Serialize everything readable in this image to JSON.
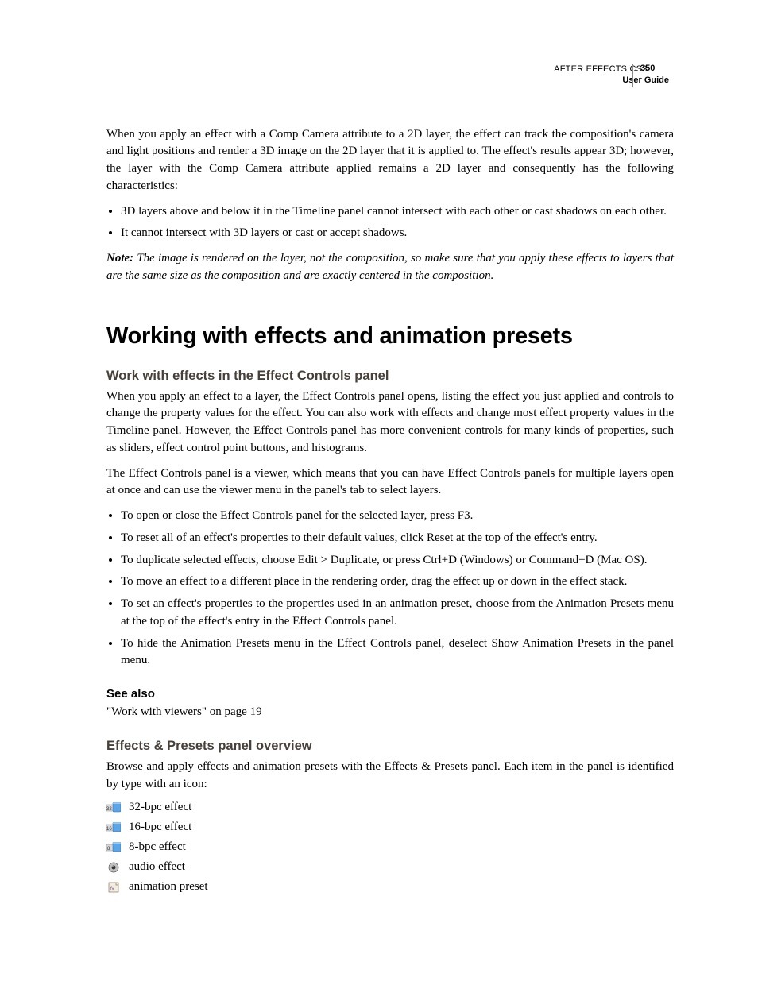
{
  "header": {
    "product": "AFTER EFFECTS CS3",
    "guide": "User Guide",
    "page": "350"
  },
  "intro": {
    "p1": "When you apply an effect with a Comp Camera attribute to a 2D layer, the effect can track the composition's camera and light positions and render a 3D image on the 2D layer that it is applied to. The effect's results appear 3D; however, the layer with the Comp Camera attribute applied remains a 2D layer and consequently has the following characteristics:",
    "bullets": [
      "3D layers above and below it in the Timeline panel cannot intersect with each other or cast shadows on each other.",
      "It cannot intersect with 3D layers or cast or accept shadows."
    ],
    "note_label": "Note:",
    "note_body": " The image is rendered on the layer, not the composition, so make sure that you apply these effects to layers that are the same size as the composition and are exactly centered in the composition."
  },
  "section_title": "Working with effects and animation presets",
  "topic1": {
    "title": "Work with effects in the Effect Controls panel",
    "p1": "When you apply an effect to a layer, the Effect Controls panel opens, listing the effect you just applied and controls to change the property values for the effect. You can also work with effects and change most effect property values in the Timeline panel. However, the Effect Controls panel has more convenient controls for many kinds of properties, such as sliders, effect control point buttons, and histograms.",
    "p2": "The Effect Controls panel is a viewer, which means that you can have Effect Controls panels for multiple layers open at once and can use the viewer menu in the panel's tab to select layers.",
    "bullets": [
      "To open or close the Effect Controls panel for the selected layer, press F3.",
      "To reset all of an effect's properties to their default values, click Reset at the top of the effect's entry.",
      "To duplicate selected effects, choose Edit > Duplicate, or press Ctrl+D (Windows) or Command+D (Mac OS).",
      "To move an effect to a different place in the rendering order, drag the effect up or down in the effect stack.",
      "To set an effect's properties to the properties used in an animation preset, choose from the Animation Presets menu at the top of the effect's entry in the Effect Controls panel.",
      "To hide the Animation Presets menu in the Effect Controls panel, deselect Show Animation Presets in the panel menu."
    ],
    "see_also_label": "See also",
    "see_also_text": "\"Work with viewers\" on page 19"
  },
  "topic2": {
    "title": "Effects & Presets panel overview",
    "p1": "Browse and apply effects and animation presets with the Effects & Presets panel. Each item in the panel is identified by type with an icon:",
    "icons": [
      {
        "name": "32-bpc-effect-icon",
        "label": "32-bpc effect"
      },
      {
        "name": "16-bpc-effect-icon",
        "label": "16-bpc effect"
      },
      {
        "name": "8-bpc-effect-icon",
        "label": "8-bpc effect"
      },
      {
        "name": "audio-effect-icon",
        "label": "audio  effect"
      },
      {
        "name": "animation-preset-icon",
        "label": "animation preset"
      }
    ]
  }
}
